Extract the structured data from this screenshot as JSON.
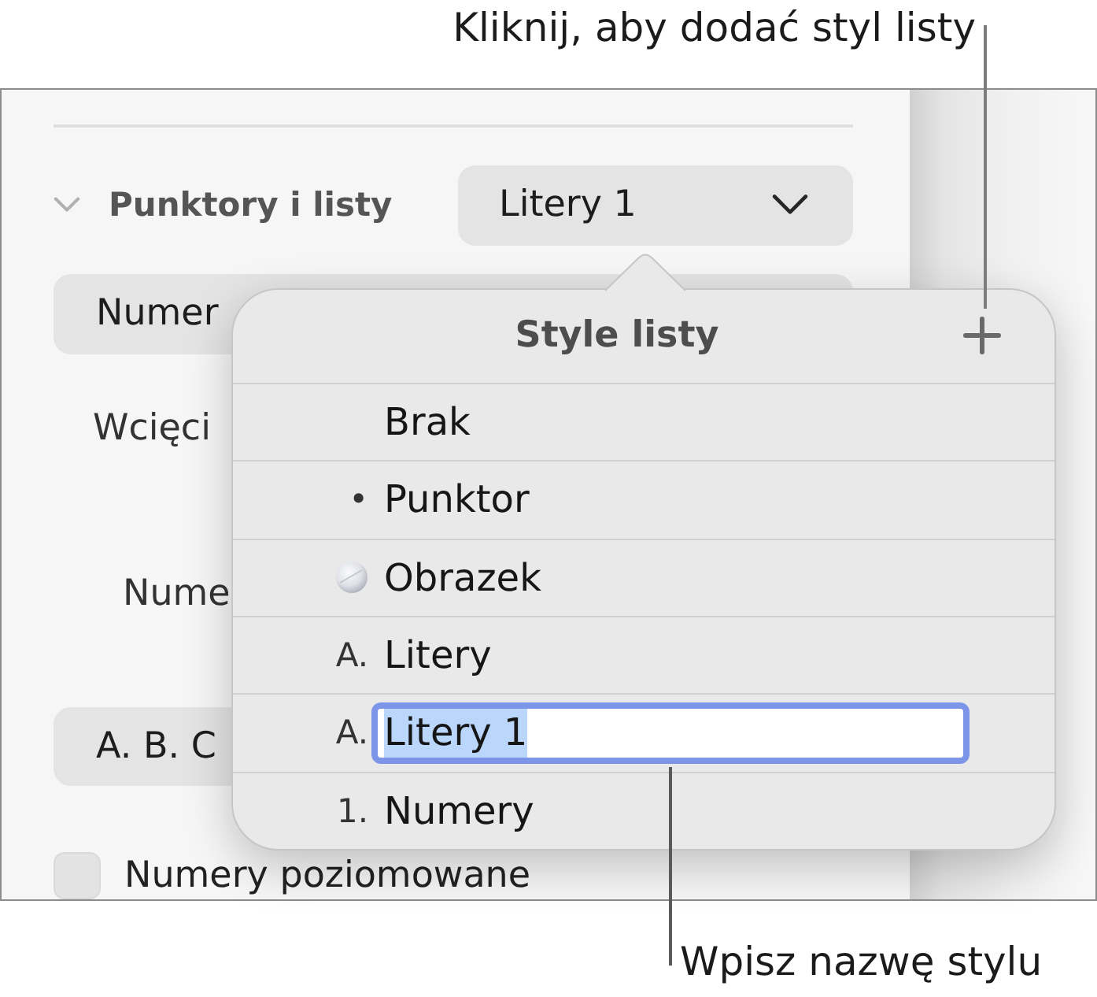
{
  "callouts": {
    "top": "Kliknij, aby dodać styl listy",
    "bottom": "Wpisz nazwę stylu"
  },
  "sidebar": {
    "section": {
      "title": "Punktory i listy",
      "expanded": true,
      "style_popup": "Litery 1"
    },
    "list_type_popup": "Numer",
    "indent_label": "Wcięci",
    "numbers_label": "Nume",
    "format_popup": "A. B. C",
    "tiered_numbers": {
      "label": "Numery poziomowane",
      "checked": false
    }
  },
  "popover": {
    "title": "Style listy",
    "rows": [
      {
        "kind": "none",
        "label": "Brak",
        "editing": false
      },
      {
        "kind": "text",
        "marker": "•",
        "label": "Punktor",
        "editing": false
      },
      {
        "kind": "image",
        "label": "Obrazek",
        "editing": false
      },
      {
        "kind": "text",
        "marker": "A.",
        "label": "Litery",
        "editing": false
      },
      {
        "kind": "text",
        "marker": "A.",
        "label": "Litery 1",
        "editing": true,
        "text_selected": true
      },
      {
        "kind": "text",
        "marker": "1.",
        "label": "Numery",
        "editing": false
      }
    ]
  }
}
